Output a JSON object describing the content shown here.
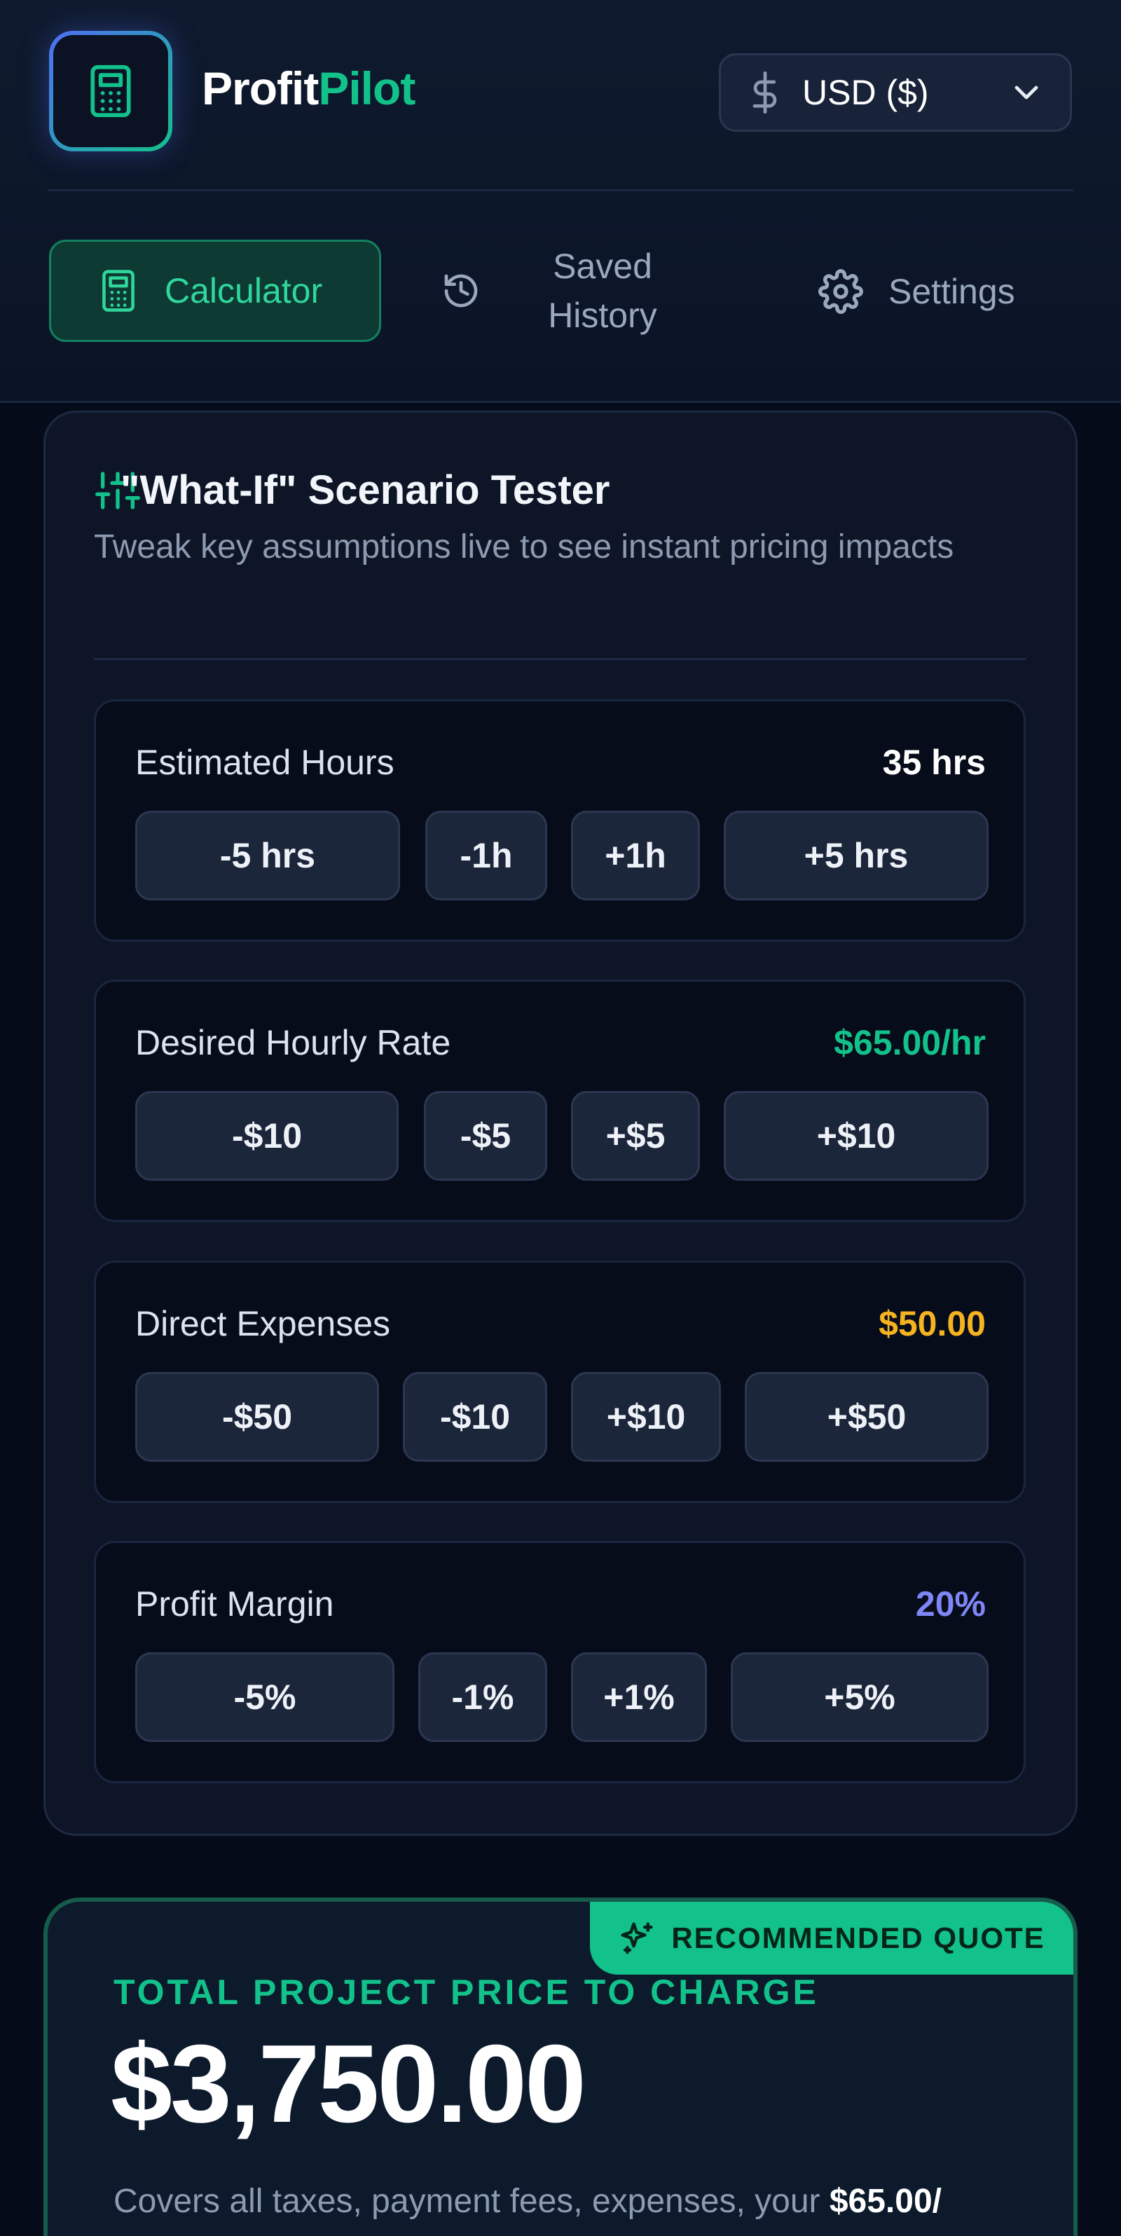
{
  "app": {
    "brand_part1": "Profit",
    "brand_part2": "Pilot",
    "currency_label": "USD ($)"
  },
  "nav": {
    "tabs": [
      {
        "label": "Calculator",
        "icon": "calculator-icon",
        "active": true
      },
      {
        "label": "Saved History",
        "icon": "history-icon",
        "active": false
      },
      {
        "label": "Settings",
        "icon": "gear-icon",
        "active": false
      }
    ]
  },
  "scenario": {
    "title": "\"What-If\" Scenario Tester",
    "subtitle": "Tweak key assumptions live to see instant pricing impacts",
    "controls": [
      {
        "label": "Estimated Hours",
        "value": "35 hrs",
        "value_color": "#ffffff",
        "buttons": [
          "-5 hrs",
          "-1h",
          "+1h",
          "+5 hrs"
        ]
      },
      {
        "label": "Desired Hourly Rate",
        "value": "$65.00/hr",
        "value_color": "#12c28a",
        "buttons": [
          "-$10",
          "-$5",
          "+$5",
          "+$10"
        ]
      },
      {
        "label": "Direct Expenses",
        "value": "$50.00",
        "value_color": "#f5b320",
        "buttons": [
          "-$50",
          "-$10",
          "+$10",
          "+$50"
        ]
      },
      {
        "label": "Profit Margin",
        "value": "20%",
        "value_color": "#7f86f5",
        "buttons": [
          "-5%",
          "-1%",
          "+1%",
          "+5%"
        ]
      }
    ]
  },
  "quote": {
    "ribbon": "RECOMMENDED QUOTE",
    "label": "TOTAL PROJECT PRICE TO CHARGE",
    "price": "$3,750.00",
    "note_prefix": "Covers all taxes, payment fees, expenses, your ",
    "note_bold": "$65.00/"
  },
  "colors": {
    "accent": "#12c28a",
    "background": "#060b1a"
  }
}
